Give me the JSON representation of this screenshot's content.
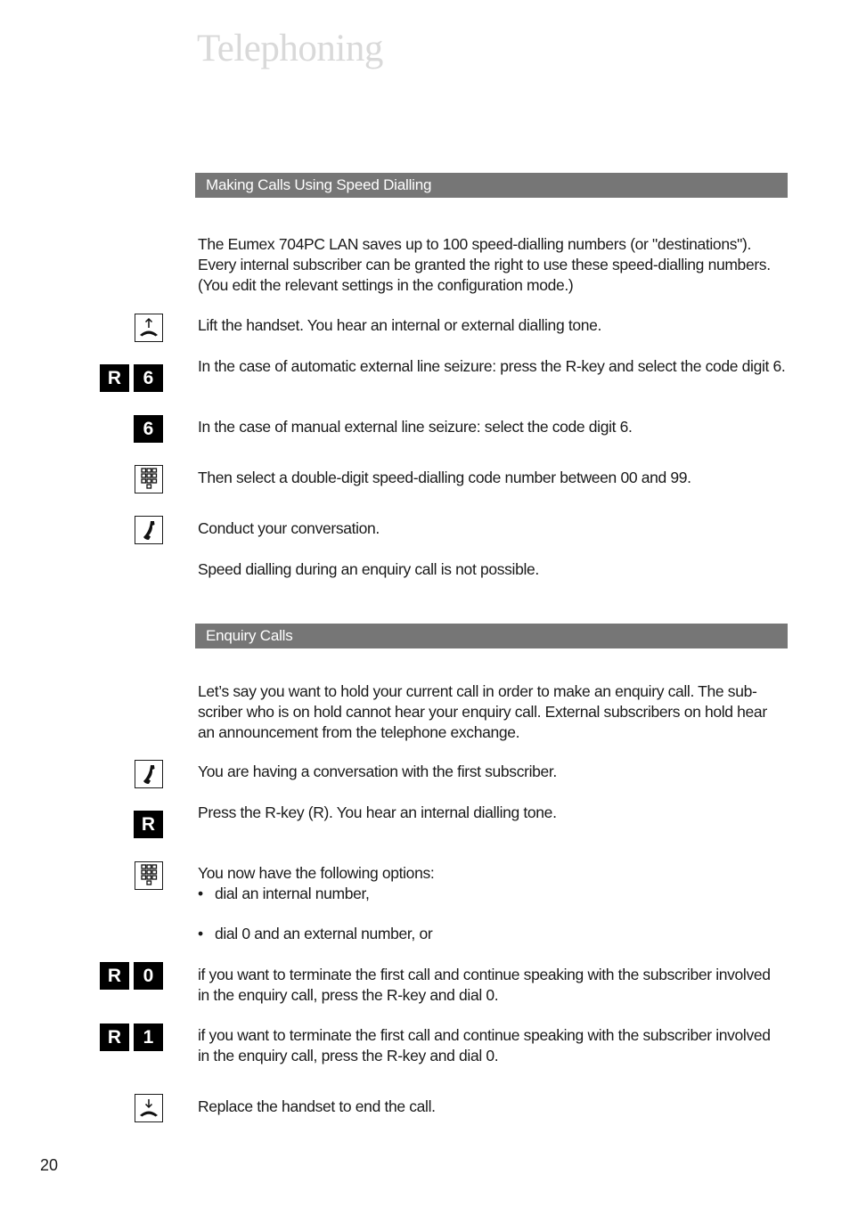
{
  "page": {
    "title": "Telephoning",
    "page_number": "20"
  },
  "section1": {
    "heading": "Making Calls Using Speed Dialling",
    "intro": "The Eumex 704PC LAN saves up to 100 speed-dialling numbers (or \"destinations\"). Every internal subscriber can be granted the right to use these speed-dialling num­bers. (You edit the relevant settings in the configuration mode.)",
    "steps": [
      {
        "icon": "lift-handset-icon",
        "text": "Lift the handset. You hear an internal or external dialling tone."
      },
      {
        "keys": [
          "R",
          "6"
        ],
        "text": "In the case of automatic external line seizure: press the R-key and select the code digit 6."
      },
      {
        "keys": [
          "6"
        ],
        "text": "In the case of manual external line seizure: select the code digit 6."
      },
      {
        "icon": "keypad-icon",
        "text": "Then select a double-digit speed-dialling code number between 00 and 99."
      },
      {
        "icon": "conversation-handset-icon",
        "text": "Conduct your conversation."
      }
    ],
    "note": "Speed dialling during an enquiry call is not possible."
  },
  "section2": {
    "heading": "Enquiry Calls",
    "intro": "Let’s say you want to hold your current call in order to make an enquiry call. The sub­scriber who is on hold cannot hear your enquiry call. External subscribers on hold hear an announcement from the telephone exchange.",
    "steps": [
      {
        "icon": "conversation-handset-icon",
        "text": "You are having a conversation with the first subscriber."
      },
      {
        "keys": [
          "R"
        ],
        "text": "Press the R-key (R). You hear an internal dialling tone."
      },
      {
        "icon": "keypad-icon",
        "text": "You now have the following options:"
      },
      {
        "keys": [
          "R",
          "0"
        ],
        "text": "if you want to terminate the first call and continue speaking with the subscriber involved in the enquiry call, press the R-key and dial 0."
      },
      {
        "keys": [
          "R",
          "1"
        ],
        "text": "if you want to terminate the first call and continue speaking with the subscriber involved in the enquiry call, press the R-key and dial 0."
      },
      {
        "icon": "replace-handset-icon",
        "text": "Replace the handset to end the call."
      }
    ],
    "bullets": [
      "dial an internal number,",
      "dial 0 and an external number, or"
    ],
    "bullet_symbol": "•"
  }
}
